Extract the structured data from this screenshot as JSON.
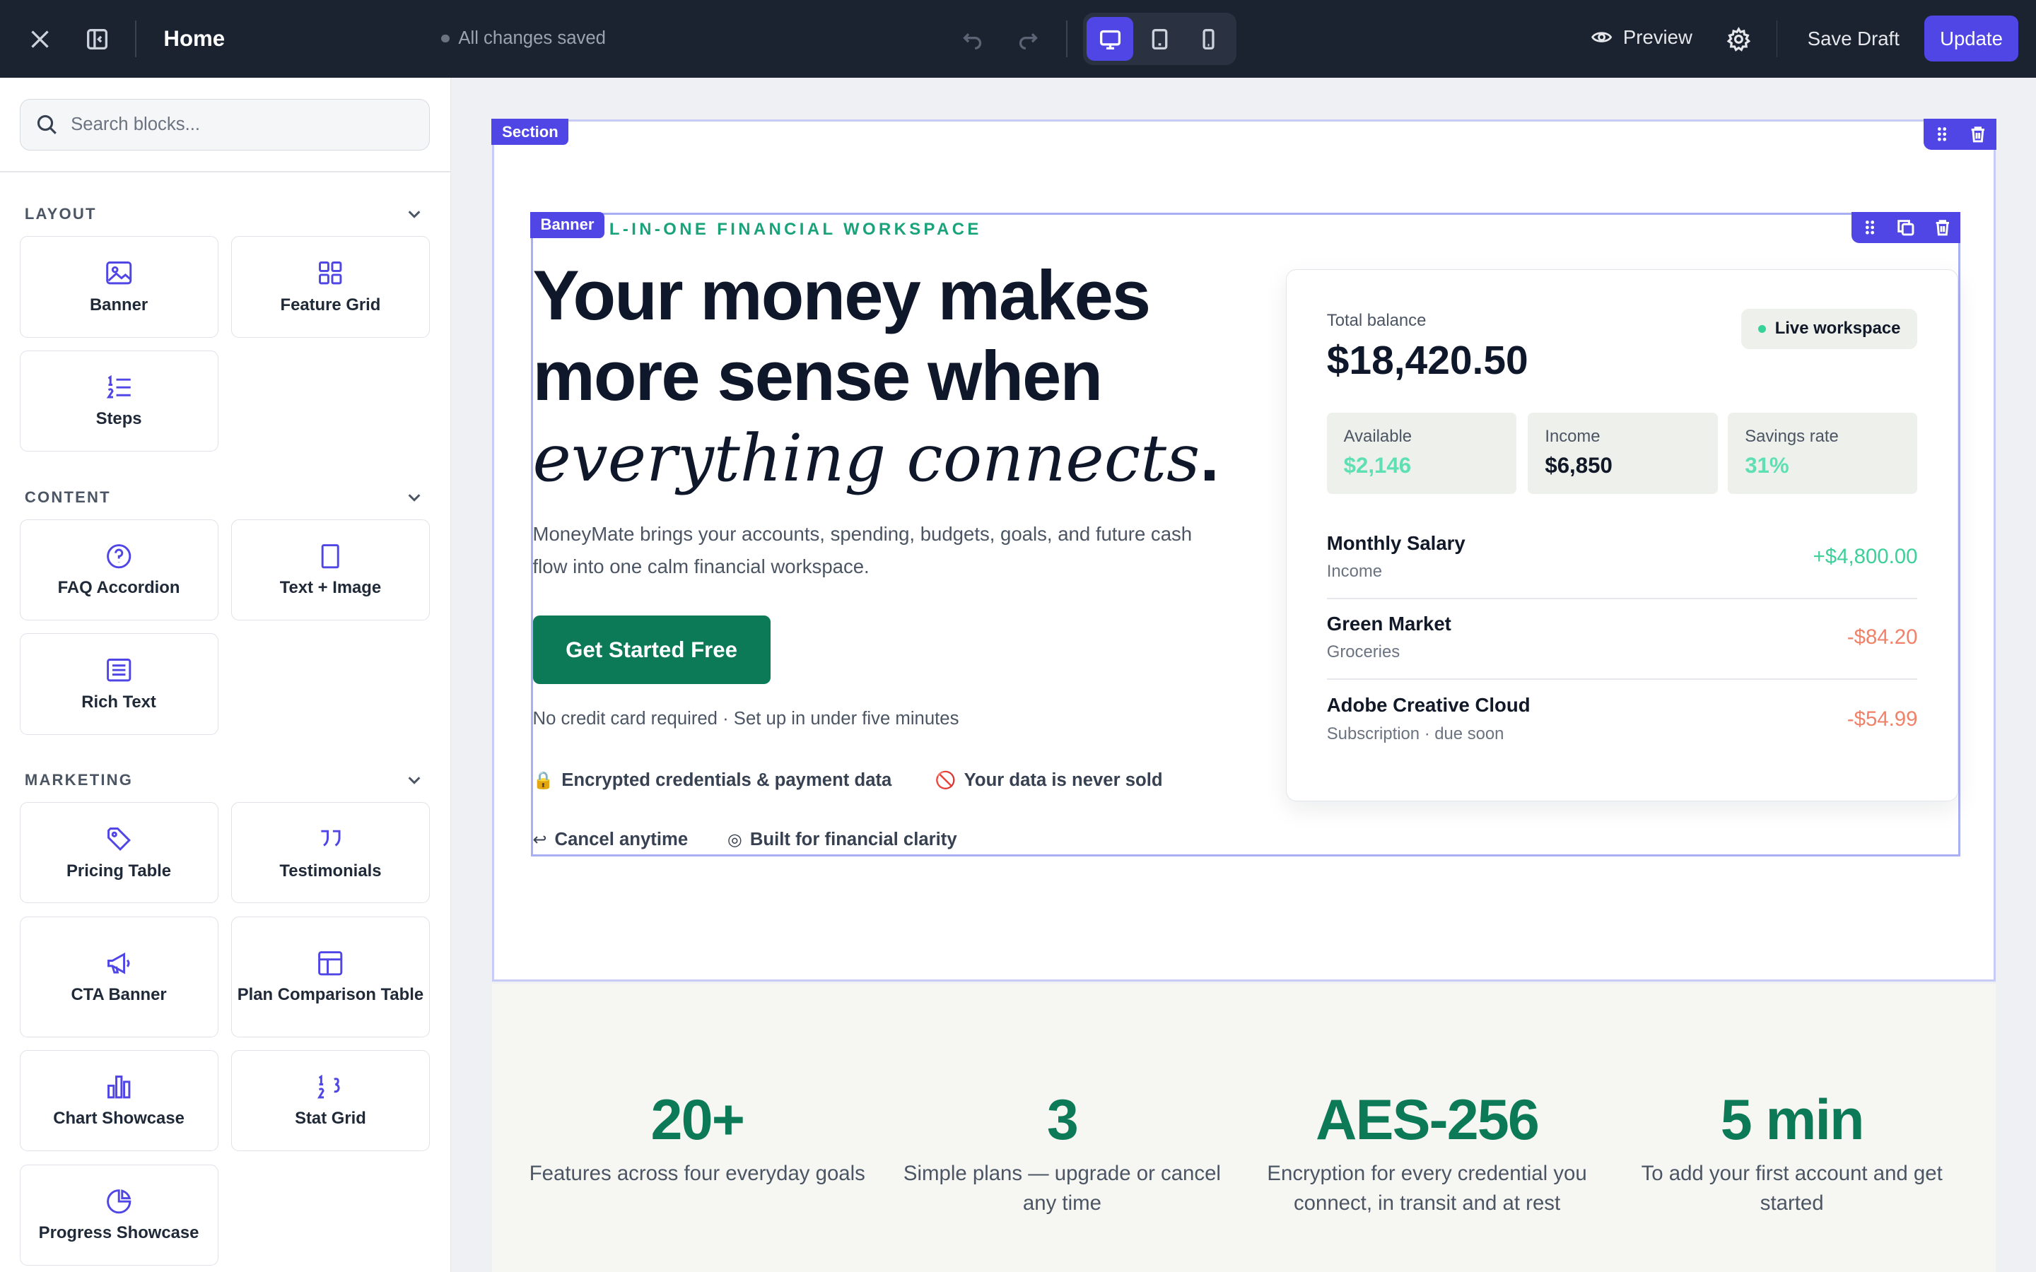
{
  "topbar": {
    "page_title": "Home",
    "save_status": "All changes saved",
    "preview_label": "Preview",
    "save_draft_label": "Save Draft",
    "update_label": "Update"
  },
  "sidebar": {
    "search_placeholder": "Search blocks...",
    "groups": [
      {
        "title": "LAYOUT",
        "blocks": [
          "Banner",
          "Feature Grid",
          "Steps"
        ]
      },
      {
        "title": "CONTENT",
        "blocks": [
          "FAQ Accordion",
          "Text + Image",
          "Rich Text"
        ]
      },
      {
        "title": "MARKETING",
        "blocks": [
          "Pricing Table",
          "Testimonials",
          "CTA Banner",
          "Plan Comparison Table",
          "Chart Showcase",
          "Stat Grid",
          "Progress Showcase"
        ]
      }
    ]
  },
  "canvas": {
    "section_tag": "Section",
    "banner_tag": "Banner",
    "eyebrow": "L-IN-ONE FINANCIAL WORKSPACE",
    "headline_line1": "Your money makes",
    "headline_line2": "more sense when",
    "headline_italic": "everything connects",
    "headline_period": ".",
    "subcopy": "MoneyMate brings your accounts, spending, budgets, goals, and future cash flow into one calm financial workspace.",
    "cta_label": "Get Started Free",
    "cta_note": "No credit card required · Set up in under five minutes",
    "trust": [
      {
        "icon": "🔒",
        "text": "Encrypted credentials & payment data"
      },
      {
        "icon": "🚫",
        "text": "Your data is never sold"
      },
      {
        "icon": "↩",
        "text": "Cancel anytime"
      },
      {
        "icon": "◎",
        "text": "Built for financial clarity"
      }
    ],
    "card": {
      "balance_label": "Total balance",
      "balance_value": "$18,420.50",
      "live_label": "Live workspace",
      "minis": [
        {
          "label": "Available",
          "value": "$2,146",
          "color": "#5ee0b4"
        },
        {
          "label": "Income",
          "value": "$6,850",
          "color": "#111827"
        },
        {
          "label": "Savings rate",
          "value": "31%",
          "color": "#5ee0b4"
        }
      ],
      "transactions": [
        {
          "name": "Monthly Salary",
          "category": "Income",
          "amount": "+$4,800.00",
          "color": "#3fcf9a"
        },
        {
          "name": "Green Market",
          "category": "Groceries",
          "amount": "-$84.20",
          "color": "#f0826a"
        },
        {
          "name": "Adobe Creative Cloud",
          "category": "Subscription · due soon",
          "amount": "-$54.99",
          "color": "#f0826a"
        }
      ]
    },
    "stats": [
      {
        "value": "20+",
        "desc": "Features across four everyday goals"
      },
      {
        "value": "3",
        "desc": "Simple plans — upgrade or cancel any time"
      },
      {
        "value": "AES-256",
        "desc": "Encryption for every credential you connect, in transit and at rest"
      },
      {
        "value": "5 min",
        "desc": "To add your first account and get started"
      }
    ]
  }
}
